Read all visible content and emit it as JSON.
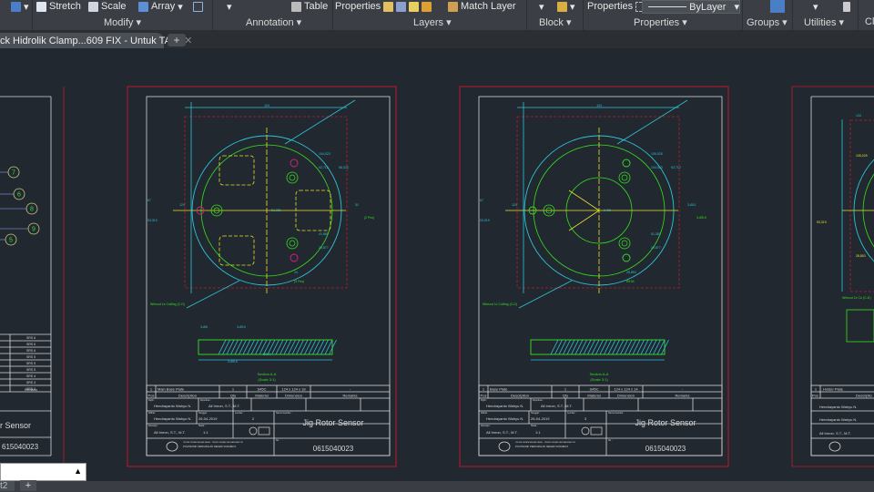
{
  "ribbon": {
    "items": [
      {
        "label": "Stretch",
        "icon": "stretch-icon"
      },
      {
        "label": "Scale",
        "icon": "scale-icon"
      },
      {
        "label": "Array",
        "icon": "array-icon"
      },
      {
        "label": "Table",
        "icon": "table-icon"
      },
      {
        "label": "Properties",
        "icon": "layer-properties-icon"
      },
      {
        "label": "Match Layer",
        "icon": "match-layer-icon"
      },
      {
        "label": "Properties",
        "icon": "properties-icon"
      }
    ],
    "linetype": "ByLayer",
    "panels": [
      "Modify",
      "Annotation",
      "Layers",
      "Block",
      "Properties",
      "Groups",
      "Utilities",
      "Cl"
    ]
  },
  "tabs": {
    "active": "ck Hidrolik Clamp...609 FIX - Untuk TA*",
    "new_tab": "+"
  },
  "layout_tabs": [
    "t2",
    "+"
  ],
  "colors": {
    "background": "#212830",
    "sheet_border": "#c0182a",
    "frame": "#d8d8d8",
    "outline": "#2ec4d6",
    "part": "#39e01f",
    "centerline": "#e8e02a",
    "hole_marker": "#e0207a"
  },
  "left_sheet": {
    "balloons": [
      "7",
      "6",
      "8",
      "9",
      "5"
    ],
    "remarks": [
      "SRS 6",
      "SRS 6",
      "SRS 6",
      "SRS 5",
      "SRS 5",
      "SRS 5",
      "SRS 4",
      "SRS 3",
      "SRS 2"
    ],
    "remarks_header": "Remarks",
    "title_partial": "r Sensor",
    "number_partial": "615040023"
  },
  "sheets": [
    {
      "dims": [
        "124",
        "124",
        "67",
        "53,319",
        "104,023",
        "92,712",
        "98,023",
        "41,889",
        "29,877",
        "24",
        "(3 Pcs)",
        "51,381",
        "31",
        "(2 Pcs)",
        "Ø194",
        "3-Ø6",
        "3-Ø10",
        "3-Ø5,5"
      ],
      "note": "Wirecut 1x Cutting (C-D)",
      "section": "Section A-A",
      "scale": "(Scale 3:1)",
      "part": {
        "pos": "1",
        "desc": "Main Base Plate",
        "qty": "1",
        "material": "S45C",
        "dimension": "124 x 124 x 18",
        "remarks": "-"
      },
      "sheet_no": "2"
    },
    {
      "dims": [
        "124",
        "124",
        "67",
        "53,319",
        "105,025",
        "104,023",
        "92,712",
        "51,381",
        "29,877",
        "28,853",
        "Ø194",
        "3-Ø6",
        "3-Ø11",
        "3-Ø5,5"
      ],
      "note": "Wirecut 1x Cutting (C-D)",
      "section": "Section A-A",
      "scale": "(Scale 3:1)",
      "part": {
        "pos": "1",
        "desc": "Base Plate",
        "qty": "1",
        "material": "S45C",
        "dimension": "124 x 124 x 14",
        "remarks": "-"
      },
      "sheet_no": "3"
    }
  ],
  "right_sheet": {
    "dims": [
      "124",
      "105,025",
      "53,319",
      "28,853"
    ],
    "note": "Wirecut 1x Cu (C-D)",
    "part": {
      "pos": "1",
      "desc": "Holder Plate"
    },
    "header_pos": "Pos",
    "header_desc": "Descriptio",
    "drawn": "Hendrayanto Wahyu N.",
    "checked": "Ali Imron, S.T., M.T."
  },
  "title_block": {
    "headers": [
      "Pos",
      "Description",
      "Qty",
      "Material",
      "Dimension",
      "Remarks"
    ],
    "drawn_label": "Digbr :",
    "drawn": "Hendrayanto Wahyu N.",
    "approved_label": "Diperiksa :",
    "approved": "Ali Imron, S.T., M.T.",
    "date_drawn_label": "Dilihat :",
    "date_label": "Tanggal :",
    "date": "26-04-2019",
    "sheet_label": "Lembar :",
    "checked_label": "Disetujui :",
    "checked": "Ali Imron, S.T., M.T.",
    "scale_label": "Skala :",
    "scale": "1:1",
    "drawing_name_label": "Nama Gambar :",
    "title": "Jig Rotor Sensor",
    "institute1": "TEKNIK PERANCANGAN KAPAL - TEKNIK DESAIN DAN MANUFAKTUR",
    "institute2": "POLITEKNIK PERKAPALAN NEGERI SURABAYA",
    "no_label": "No :",
    "number": "0615040023"
  }
}
